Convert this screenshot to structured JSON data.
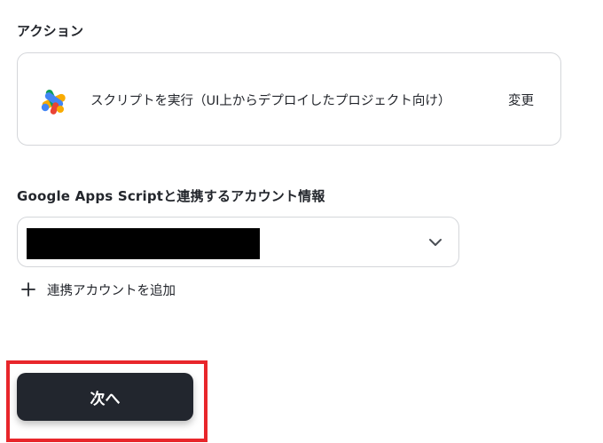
{
  "action_section": {
    "label": "アクション",
    "action_text": "スクリプトを実行（UI上からデプロイしたプロジェクト向け）",
    "change_label": "変更",
    "icon": "google-apps-script-icon"
  },
  "account_section": {
    "label": "Google Apps Scriptと連携するアカウント情報",
    "selected_value_redacted": true,
    "chevron_icon": "chevron-down-icon",
    "add_account_label": "連携アカウントを追加",
    "add_icon": "plus-icon"
  },
  "footer": {
    "next_label": "次へ",
    "highlight_color": "#e8262b"
  },
  "colors": {
    "button_bg": "#22262e",
    "border": "#d4d6da",
    "text": "#23262c"
  }
}
